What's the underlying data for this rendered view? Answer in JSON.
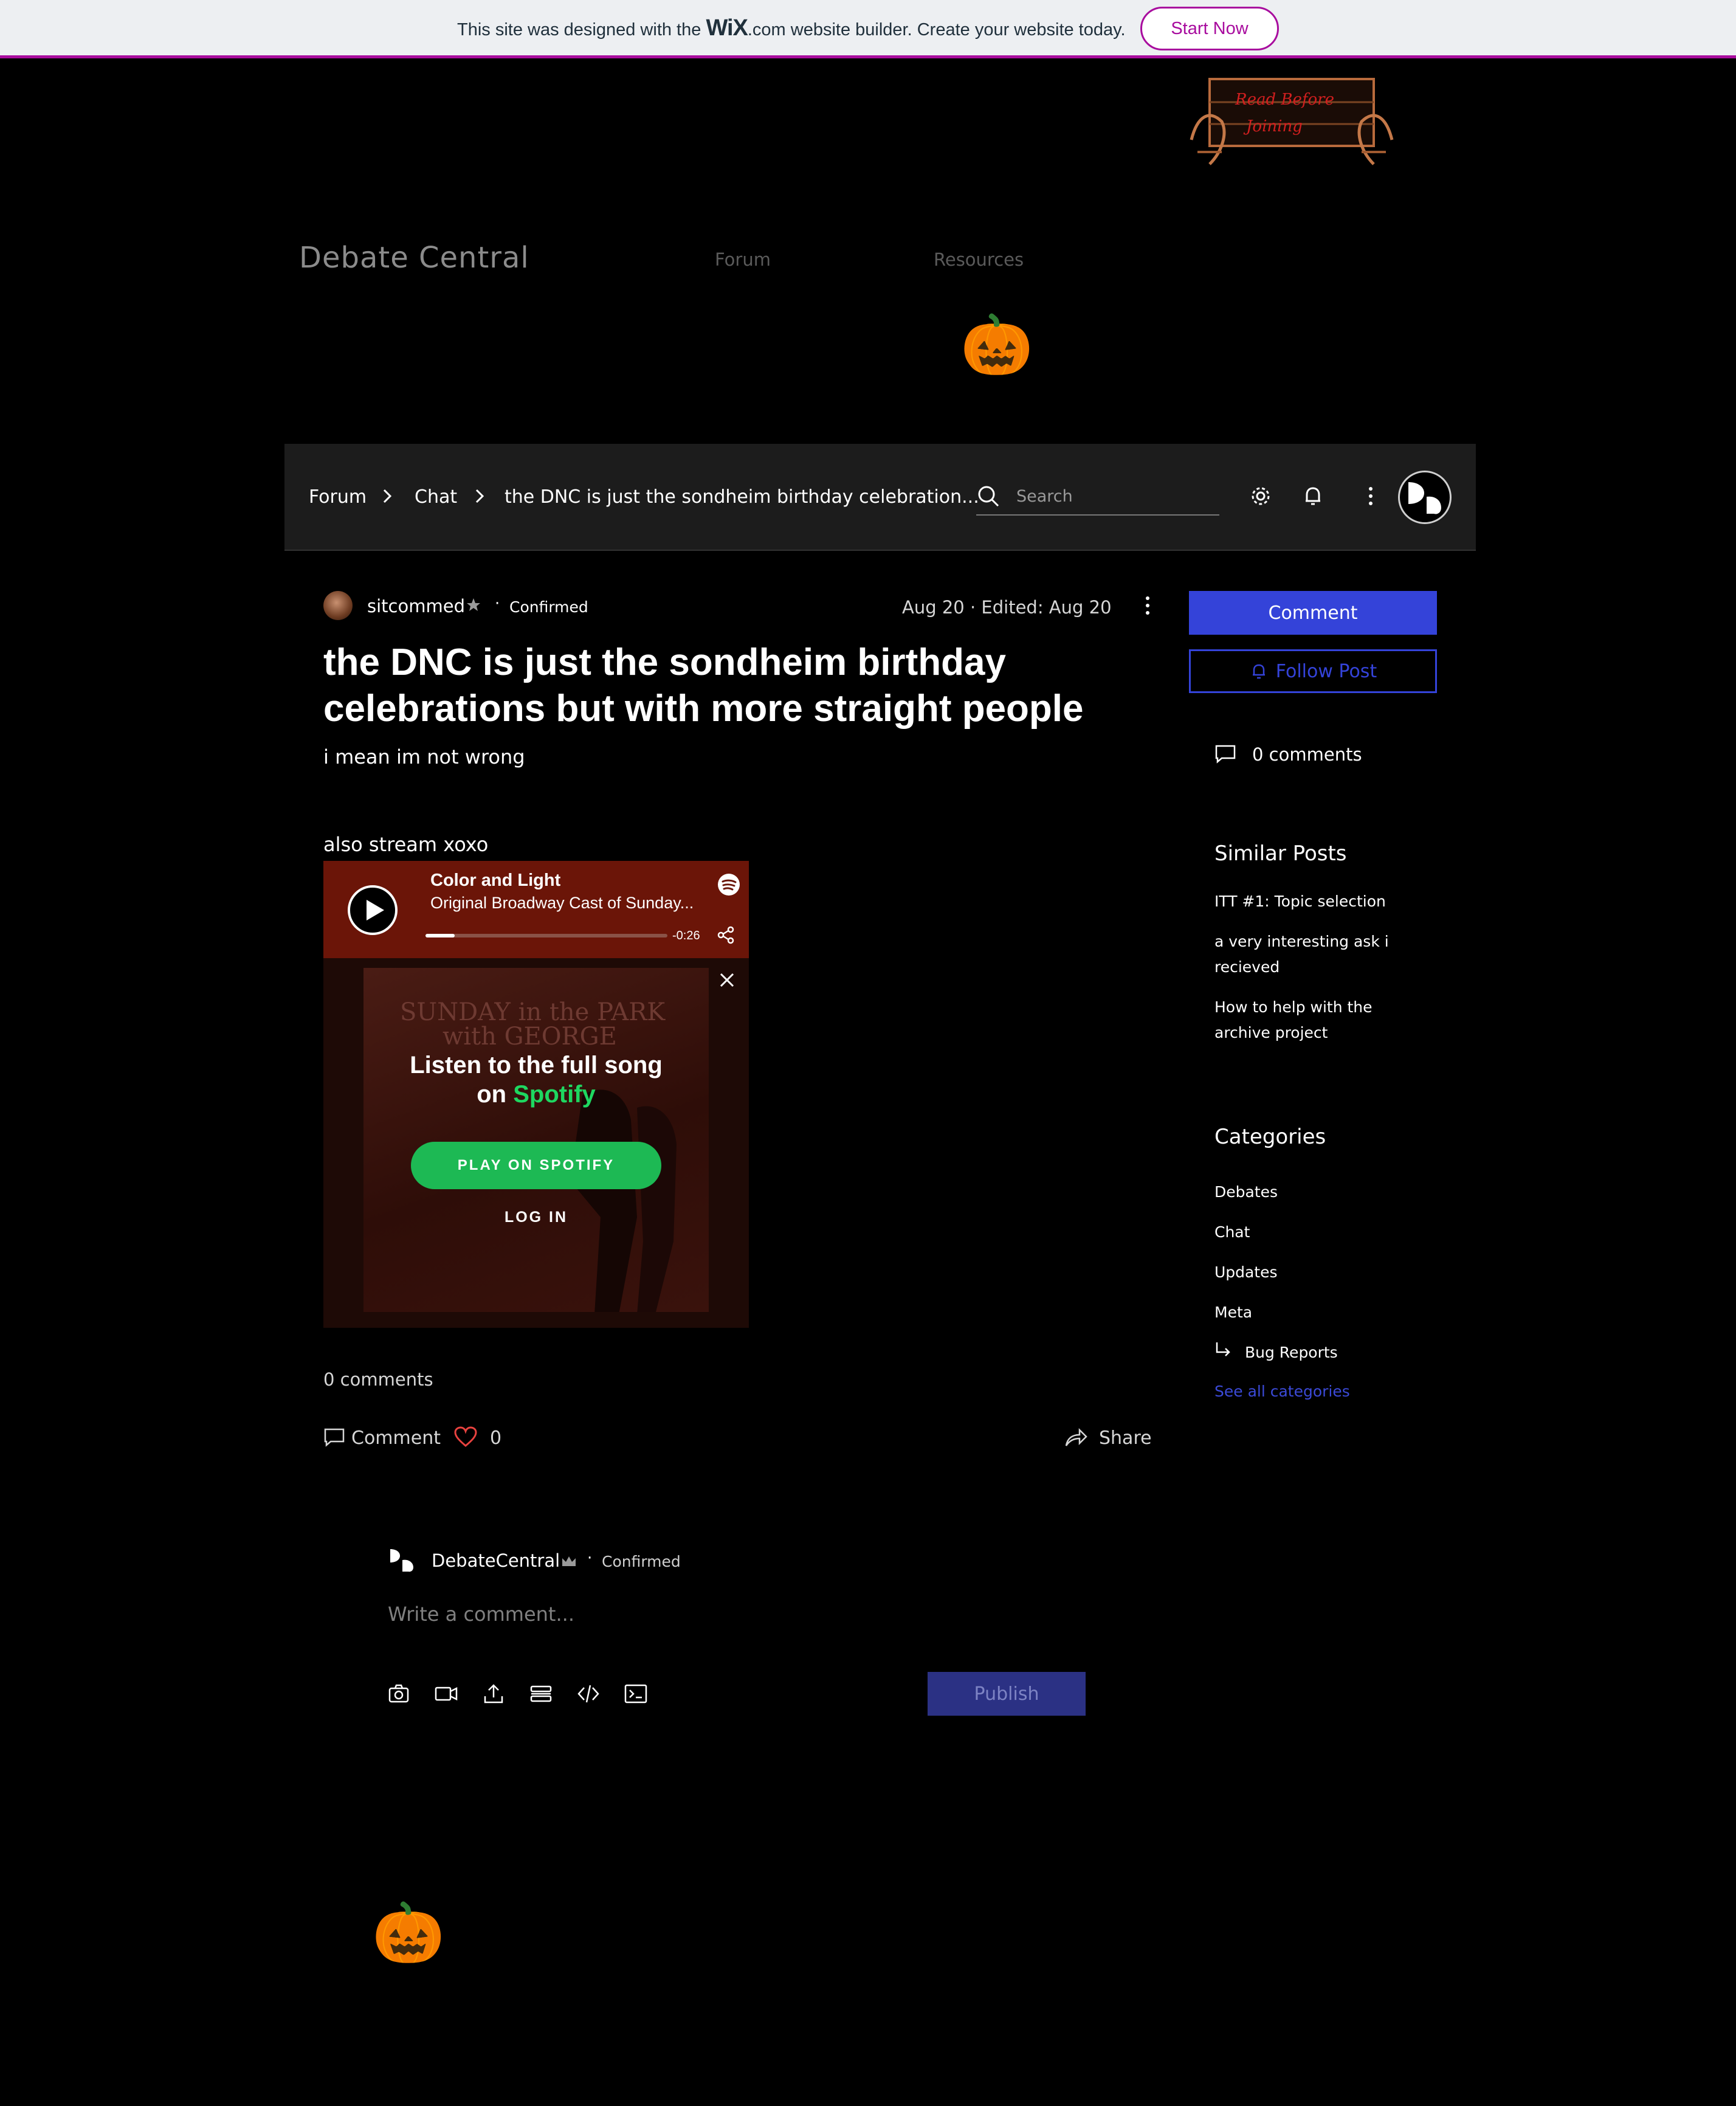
{
  "wix_banner": {
    "text_before": "This site was designed with the ",
    "logo": "WiX",
    "text_after": ".com website builder. Create your website today.",
    "button": "Start Now"
  },
  "header": {
    "sign_text_1": "Read Before",
    "sign_text_2": "Joining",
    "site_title": "Debate Central",
    "nav": [
      "Forum",
      "Resources"
    ],
    "pumpkin": "🎃"
  },
  "forum_bar": {
    "breadcrumbs": [
      "Forum",
      "Chat",
      "the DNC is just the sondheim birthday celebration..."
    ],
    "search_placeholder": "Search"
  },
  "post": {
    "author": "sitcommed",
    "author_badge": "Confirmed",
    "date": "Aug 20",
    "edited": "Edited: Aug 20",
    "title": "the DNC is just the sondheim birthday celebrations but with more straight people",
    "body_1": "i mean im not wrong",
    "body_2": "also stream xoxo",
    "comments_count": "0 comments",
    "comment_label": "Comment",
    "likes": "0",
    "share_label": "Share"
  },
  "spotify": {
    "track": "Color and Light",
    "artist": "Original Broadway Cast of Sunday...",
    "time": "-0:26",
    "progress": 0.12,
    "art_title_1": "SUNDAY in the PARK",
    "art_title_2": "with GEORGE",
    "listen_line_1": "Listen to the full song",
    "listen_on": "on ",
    "listen_brand": "Spotify",
    "play_button": "PLAY ON SPOTIFY",
    "login": "LOG IN"
  },
  "comment_box": {
    "user": "DebateCentral",
    "badge": "Confirmed",
    "placeholder": "Write a comment...",
    "publish": "Publish"
  },
  "sidebar": {
    "comment_button": "Comment",
    "follow_button": "Follow Post",
    "comments_count": "0 comments",
    "similar_heading": "Similar Posts",
    "similar_posts": [
      "ITT #1: Topic selection",
      "a very interesting ask i recieved",
      "How to help with the archive project"
    ],
    "categories_heading": "Categories",
    "categories": [
      "Debates",
      "Chat",
      "Updates",
      "Meta"
    ],
    "subcategory": "Bug Reports",
    "see_all": "See all categories"
  },
  "colors": {
    "accent": "#3443d9",
    "wix_magenta": "#a80c9e",
    "spotify_green": "#1db954",
    "like_heart": "#e8423f"
  }
}
